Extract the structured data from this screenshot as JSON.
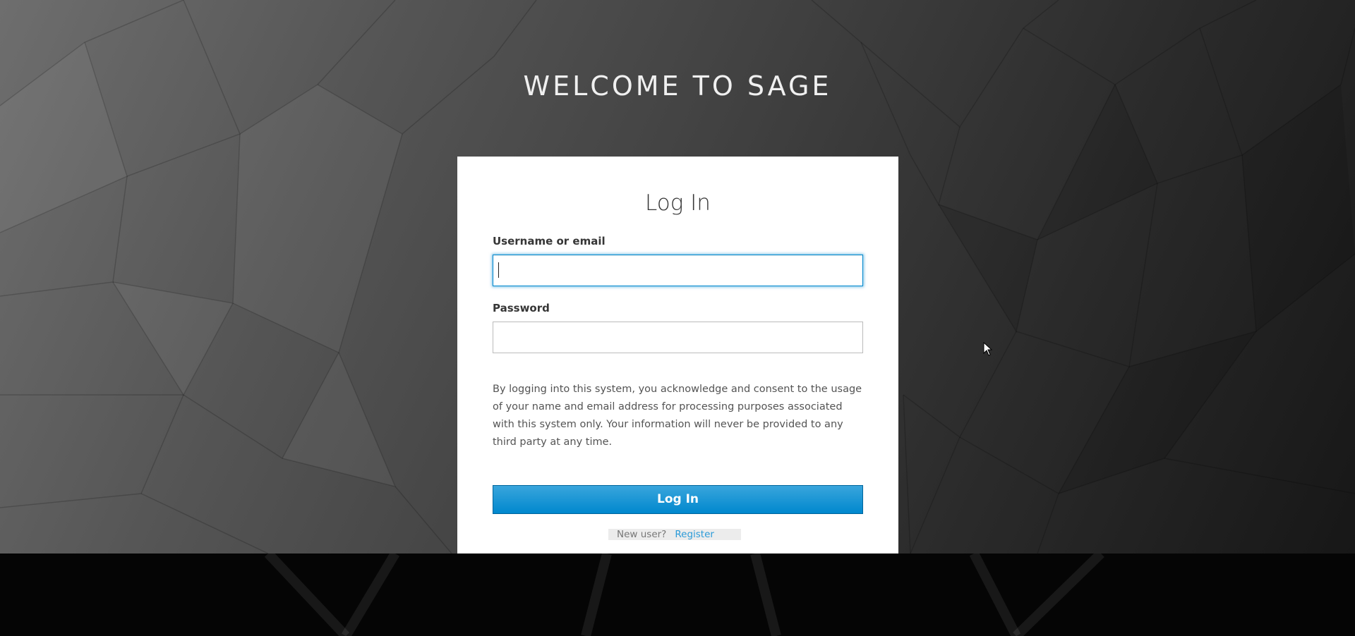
{
  "header": {
    "welcome_title": "WELCOME TO SAGE"
  },
  "login_card": {
    "title": "Log In",
    "username_label": "Username or email",
    "username_value": "",
    "password_label": "Password",
    "password_value": "",
    "consent_text": "By logging into this system, you acknowledge and consent to the usage of your name and email address for processing purposes associated with this system only. Your information will never be provided to any third party at any time.",
    "submit_label": "Log In",
    "new_user_text": "New user?",
    "register_label": "Register"
  },
  "colors": {
    "accent": "#0088ce",
    "button_top": "#39a5dc",
    "link": "#2b9bd8",
    "card_bg": "#ffffff"
  },
  "icons": {
    "pointer": "mouse-pointer-icon"
  }
}
